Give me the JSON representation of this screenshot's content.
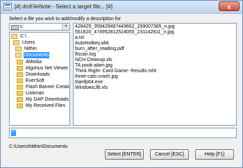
{
  "window": {
    "title": "[#] dmFileNote - Select a target file... [#]",
    "close_label": "x"
  },
  "instruction": "Select a file you wish to add/modify a description for",
  "drive": {
    "value": "c:",
    "arrow": "▾"
  },
  "tree": [
    {
      "label": "C:\\",
      "icon": "folder-open-icon",
      "selected": false
    },
    {
      "label": "Users",
      "icon": "folder-open-icon",
      "selected": false
    },
    {
      "label": "Nithin",
      "icon": "folder-open-icon",
      "selected": false
    },
    {
      "label": "Documents",
      "icon": "folder-open-icon",
      "selected": true
    },
    {
      "label": "4Media",
      "icon": "folder-icon",
      "selected": false
    },
    {
      "label": "Algorius Net Viewer",
      "icon": "folder-icon",
      "selected": false
    },
    {
      "label": "Downloads",
      "icon": "folder-icon",
      "selected": false
    },
    {
      "label": "EverSoft",
      "icon": "folder-icon",
      "selected": false
    },
    {
      "label": "Flash Banner Creator",
      "icon": "folder-icon",
      "selected": false
    },
    {
      "label": "Linkman",
      "icon": "folder-icon",
      "selected": false
    },
    {
      "label": "My DAP Downloads",
      "icon": "folder-icon",
      "selected": false
    },
    {
      "label": "My Received Files",
      "icon": "folder-icon",
      "selected": false
    }
  ],
  "files": [
    "428425_359429497449662_299007365_n.jpg",
    "551820_474952812524055_231142811_n.jpg",
    "a.txt",
    "AutoHotkey.ahk",
    "burn_after_reading.pdf",
    "ftscan.log",
    "NCH Cleanup.xls",
    "TA pook-alam.jpg",
    "Think Right- Card Game- Results.mht",
    "three-cats-crash.jpg",
    "titanfp64.exe",
    "WindowsJB.xls"
  ],
  "description": {
    "selected_text": "\"\""
  },
  "current_path": "C:\\Users\\Nithin\\Documents",
  "buttons": {
    "select": "Select [ENTER]",
    "cancel": "Cancel [ESC]",
    "help": "Help [F1]"
  }
}
